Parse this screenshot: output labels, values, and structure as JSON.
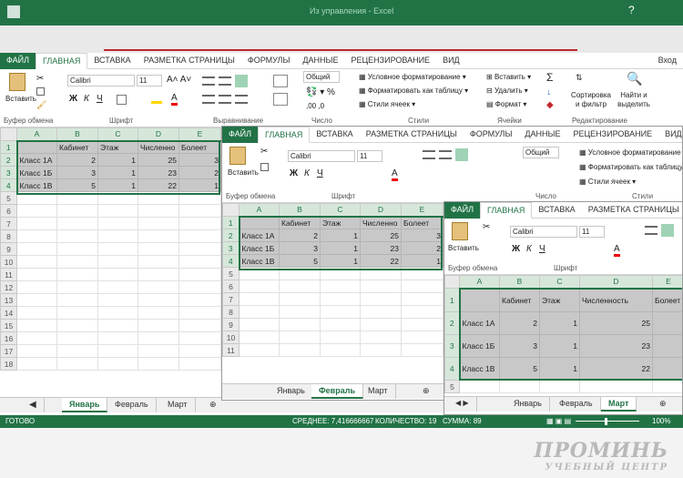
{
  "titlebar": {
    "title": "Из управления - Excel",
    "login": "Вход"
  },
  "ribbon_tabs": [
    "ФАЙЛ",
    "ГЛАВНАЯ",
    "ВСТАВКА",
    "РАЗМЕТКА СТРАНИЦЫ",
    "ФОРМУЛЫ",
    "ДАННЫЕ",
    "РЕЦЕНЗИРОВАНИЕ",
    "ВИД"
  ],
  "ribbon": {
    "paste": "Вставить",
    "clipboard": "Буфер обмена",
    "font_group": "Шрифт",
    "font_name": "Calibri",
    "font_size": "11",
    "align_group": "Выравнивание",
    "number_group": "Число",
    "number_format": "Общий",
    "styles_group": "Стили",
    "cond_format": "Условное форматирование",
    "format_table": "Форматировать как таблицу",
    "cell_styles": "Стили ячеек",
    "cells_group": "Ячейки",
    "insert": "Вставить",
    "delete": "Удалить",
    "format": "Формат",
    "edit_group": "Редактирование",
    "sort": "Сортировка и фильтр",
    "find": "Найти и выделить",
    "bold": "Ж",
    "italic": "К",
    "underline": "Ч",
    "sigma": "Σ"
  },
  "columns": [
    "A",
    "B",
    "C",
    "D",
    "E"
  ],
  "table": {
    "header": [
      "",
      "Кабинет",
      "Этаж",
      "Численно",
      "Болеет"
    ],
    "header_full": [
      "",
      "Кабинет",
      "Этаж",
      "Численность",
      "Болеет"
    ],
    "rows": [
      [
        "Класс 1А",
        "2",
        "1",
        "25",
        "3"
      ],
      [
        "Класс 1Б",
        "3",
        "1",
        "23",
        "2"
      ],
      [
        "Класс 1В",
        "5",
        "1",
        "22",
        "1"
      ]
    ]
  },
  "sheets": [
    "Январь",
    "Февраль",
    "Март"
  ],
  "status": {
    "ready": "ГОТОВО",
    "average": "СРЕДНЕЕ: 7,416666667",
    "count": "КОЛИЧЕСТВО: 19",
    "sum": "СУММА: 89",
    "zoom": "100%"
  },
  "watermark": {
    "line1": "ПРОМИНЬ",
    "line2": "УЧЕБНЫЙ ЦЕНТР"
  },
  "colors": {
    "excel_green": "#217346",
    "selection_gray": "#c8c8c8"
  }
}
